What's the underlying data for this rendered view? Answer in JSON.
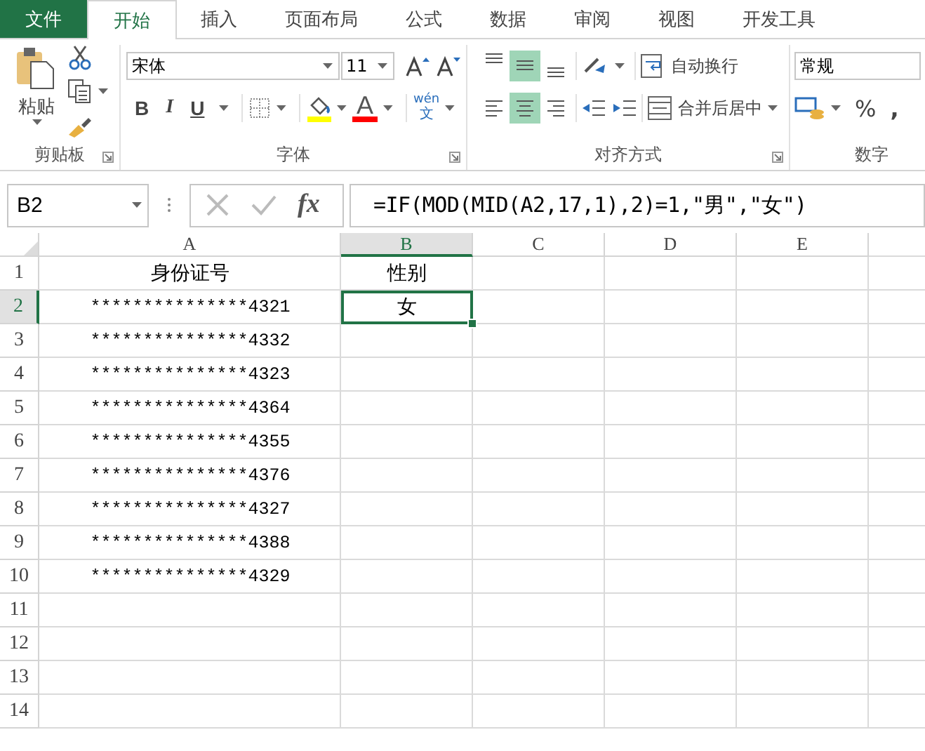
{
  "tabs": [
    {
      "label": "文件",
      "kind": "file",
      "selected": false
    },
    {
      "label": "开始",
      "kind": "tab",
      "selected": true
    },
    {
      "label": "插入",
      "kind": "tab",
      "selected": false
    },
    {
      "label": "页面布局",
      "kind": "tab",
      "selected": false
    },
    {
      "label": "公式",
      "kind": "tab",
      "selected": false
    },
    {
      "label": "数据",
      "kind": "tab",
      "selected": false
    },
    {
      "label": "审阅",
      "kind": "tab",
      "selected": false
    },
    {
      "label": "视图",
      "kind": "tab",
      "selected": false
    },
    {
      "label": "开发工具",
      "kind": "tab",
      "selected": false
    }
  ],
  "ribbon": {
    "clipboard": {
      "paste_label": "粘贴",
      "group_label": "剪贴板"
    },
    "font": {
      "font_name": "宋体",
      "font_size": "11",
      "bold": "B",
      "italic": "I",
      "underline": "U",
      "font_color_letter": "A",
      "phonetic_top": "wén",
      "phonetic_bottom": "文",
      "group_label": "字体"
    },
    "alignment": {
      "vertical": [
        {
          "kind": "top",
          "selected": false
        },
        {
          "kind": "middle",
          "selected": true
        },
        {
          "kind": "bottom",
          "selected": false
        }
      ],
      "horizontal": [
        {
          "kind": "left",
          "selected": false
        },
        {
          "kind": "center",
          "selected": true
        },
        {
          "kind": "right",
          "selected": false
        }
      ],
      "wrap_text": "自动换行",
      "merge_center": "合并后居中",
      "group_label": "对齐方式"
    },
    "number": {
      "format": "常规",
      "percent": "%",
      "comma": ",",
      "group_label": "数字"
    }
  },
  "formula_bar": {
    "name_box": "B2",
    "fx": "fx",
    "formula": "=IF(MOD(MID(A2,17,1),2)=1,\"男\",\"女\")"
  },
  "sheet": {
    "columns": [
      {
        "label": "A",
        "selected": false
      },
      {
        "label": "B",
        "selected": true
      },
      {
        "label": "C",
        "selected": false
      },
      {
        "label": "D",
        "selected": false
      },
      {
        "label": "E",
        "selected": false
      }
    ],
    "rows": [
      {
        "header": "1",
        "selected": false,
        "cells": [
          {
            "text": "身份证号",
            "selected": false
          },
          {
            "text": "性别",
            "selected": false
          }
        ]
      },
      {
        "header": "2",
        "selected": true,
        "cells": [
          {
            "text": "***************4321",
            "selected": false
          },
          {
            "text": "女",
            "selected": true
          }
        ]
      },
      {
        "header": "3",
        "selected": false,
        "cells": [
          {
            "text": "***************4332",
            "selected": false
          }
        ]
      },
      {
        "header": "4",
        "selected": false,
        "cells": [
          {
            "text": "***************4323",
            "selected": false
          }
        ]
      },
      {
        "header": "5",
        "selected": false,
        "cells": [
          {
            "text": "***************4364",
            "selected": false
          }
        ]
      },
      {
        "header": "6",
        "selected": false,
        "cells": [
          {
            "text": "***************4355",
            "selected": false
          }
        ]
      },
      {
        "header": "7",
        "selected": false,
        "cells": [
          {
            "text": "***************4376",
            "selected": false
          }
        ]
      },
      {
        "header": "8",
        "selected": false,
        "cells": [
          {
            "text": "***************4327",
            "selected": false
          }
        ]
      },
      {
        "header": "9",
        "selected": false,
        "cells": [
          {
            "text": "***************4388",
            "selected": false
          }
        ]
      },
      {
        "header": "10",
        "selected": false,
        "cells": [
          {
            "text": "***************4329",
            "selected": false
          }
        ]
      },
      {
        "header": "11",
        "selected": false
      },
      {
        "header": "12",
        "selected": false
      },
      {
        "header": "13",
        "selected": false
      },
      {
        "header": "14",
        "selected": false
      }
    ]
  }
}
